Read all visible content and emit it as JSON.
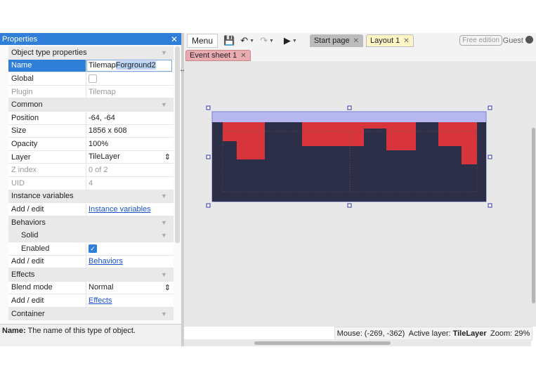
{
  "properties": {
    "title": "Properties",
    "close_icon": "close-icon",
    "rows": {
      "object_type_properties": "Object type properties",
      "name_key": "Name",
      "name_value_plain": "Tilemap",
      "name_value_selected": "Forground2",
      "global_key": "Global",
      "plugin_key": "Plugin",
      "plugin_value": "Tilemap",
      "common": "Common",
      "position_key": "Position",
      "position_value": "-64, -64",
      "size_key": "Size",
      "size_value": "1856 x 608",
      "opacity_key": "Opacity",
      "opacity_value": "100%",
      "layer_key": "Layer",
      "layer_value": "TileLayer",
      "zindex_key": "Z index",
      "zindex_value": "0 of 2",
      "uid_key": "UID",
      "uid_value": "4",
      "instance_variables": "Instance variables",
      "add_edit_1": "Add / edit",
      "instance_variables_link": "Instance variables",
      "behaviors": "Behaviors",
      "solid": "Solid",
      "enabled_key": "Enabled",
      "add_edit_2": "Add / edit",
      "behaviors_link": "Behaviors",
      "effects": "Effects",
      "blend_mode_key": "Blend mode",
      "blend_mode_value": "Normal",
      "add_edit_3": "Add / edit",
      "effects_link": "Effects",
      "container": "Container"
    },
    "description_label": "Name:",
    "description_text": " The name of this type of object."
  },
  "toolbar": {
    "menu_label": "Menu",
    "tabs": [
      {
        "label": "Start page"
      },
      {
        "label": "Layout 1"
      }
    ],
    "free_edition": "Free edition",
    "guest": "Guest"
  },
  "event_tab": {
    "label": "Event sheet 1"
  },
  "status": {
    "mouse": "Mouse: (-269, -362)",
    "active_layer_label": "Active layer: ",
    "active_layer_value": "TileLayer",
    "zoom": "Zoom: 29%"
  },
  "colors": {
    "accent": "#2f7ed8",
    "tile_red": "#d8343c",
    "tile_dark": "#2d2f48",
    "selection": "#b8b8f0"
  }
}
